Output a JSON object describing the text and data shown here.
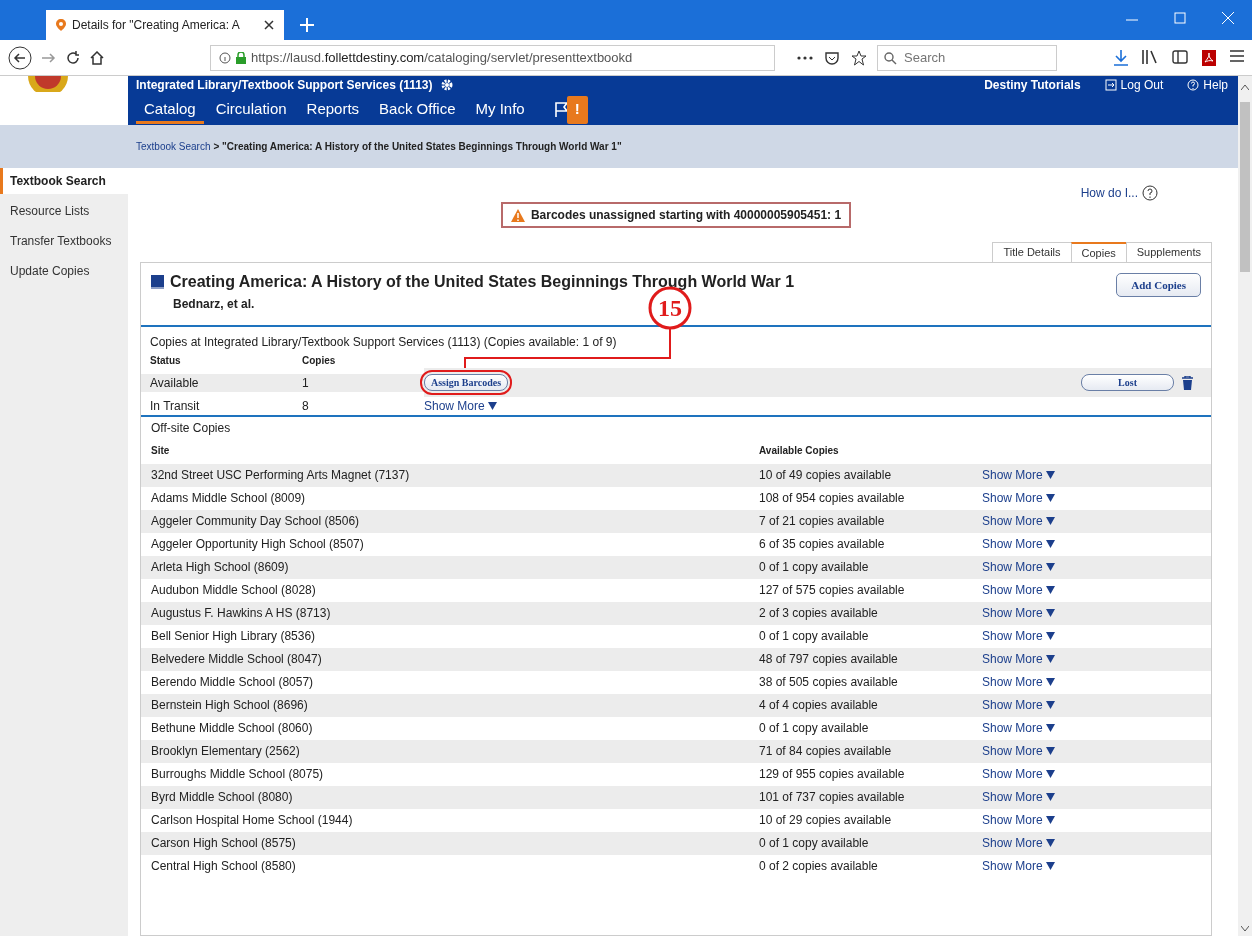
{
  "browser": {
    "tab_title": "Details for \"Creating America: A",
    "url_prefix": "https://lausd.",
    "url_domain": "follettdestiny.com",
    "url_path": "/cataloging/servlet/presenttextbookd",
    "search_placeholder": "Search"
  },
  "header": {
    "site": "Integrated Library/Textbook Support Services (1113)",
    "links": [
      "Destiny Tutorials",
      "Log Out",
      "Help"
    ],
    "nav": [
      {
        "label": "Catalog",
        "selected": true
      },
      {
        "label": "Circulation",
        "selected": false
      },
      {
        "label": "Reports",
        "selected": false
      },
      {
        "label": "Back Office",
        "selected": false
      },
      {
        "label": "My Info",
        "selected": false
      }
    ],
    "flag_badge": "!"
  },
  "breadcrumb": {
    "link": "Textbook Search",
    "current": "> \"Creating America: A History of the United States Beginnings Through World War 1\""
  },
  "sidebar": {
    "items": [
      {
        "label": "Textbook Search",
        "selected": true
      },
      {
        "label": "Resource Lists",
        "selected": false
      },
      {
        "label": "Transfer Textbooks",
        "selected": false
      },
      {
        "label": "Update Copies",
        "selected": false
      }
    ]
  },
  "help_link": "How do I...",
  "alert": "Barcodes unassigned starting with 40000005905451: 1",
  "view_tabs": [
    {
      "label": "Title Details",
      "selected": false
    },
    {
      "label": "Copies",
      "selected": true
    },
    {
      "label": "Supplements",
      "selected": false
    }
  ],
  "title": "Creating America: A History of the United States Beginnings Through World War 1",
  "author": "Bednarz, et al.",
  "add_button": "Add Copies",
  "local_copies": {
    "heading": "Copies at Integrated Library/Textbook Support Services (1113) (Copies available: 1 of 9)",
    "columns": [
      "Status",
      "Copies"
    ],
    "rows": [
      {
        "kind": "button",
        "status": "Available",
        "copies": "1",
        "action": "Assign Barcodes",
        "lost_button": "Lost"
      },
      {
        "kind": "link",
        "status": "In Transit",
        "copies": "8",
        "action": "Show More"
      }
    ]
  },
  "annotation": {
    "label": "15"
  },
  "offsite": {
    "heading": "Off-site Copies",
    "columns": [
      "Site",
      "Available Copies"
    ],
    "rows": [
      {
        "site": "32nd Street USC Performing Arts Magnet (7137)",
        "available": "10 of 49 copies available",
        "action": "Show More"
      },
      {
        "site": "Adams Middle School (8009)",
        "available": "108 of 954 copies available",
        "action": "Show More"
      },
      {
        "site": "Aggeler Community Day School (8506)",
        "available": "7 of 21 copies available",
        "action": "Show More"
      },
      {
        "site": "Aggeler Opportunity High School (8507)",
        "available": "6 of 35 copies available",
        "action": "Show More"
      },
      {
        "site": "Arleta High School (8609)",
        "available": "0 of 1 copy available",
        "action": "Show More"
      },
      {
        "site": "Audubon Middle School (8028)",
        "available": "127 of 575 copies available",
        "action": "Show More"
      },
      {
        "site": "Augustus F. Hawkins A HS (8713)",
        "available": "2 of 3 copies available",
        "action": "Show More"
      },
      {
        "site": "Bell Senior High Library (8536)",
        "available": "0 of 1 copy available",
        "action": "Show More"
      },
      {
        "site": "Belvedere Middle School (8047)",
        "available": "48 of 797 copies available",
        "action": "Show More"
      },
      {
        "site": "Berendo Middle School (8057)",
        "available": "38 of 505 copies available",
        "action": "Show More"
      },
      {
        "site": "Bernstein High School (8696)",
        "available": "4 of 4 copies available",
        "action": "Show More"
      },
      {
        "site": "Bethune Middle School (8060)",
        "available": "0 of 1 copy available",
        "action": "Show More"
      },
      {
        "site": "Brooklyn Elementary (2562)",
        "available": "71 of 84 copies available",
        "action": "Show More"
      },
      {
        "site": "Burroughs Middle School (8075)",
        "available": "129 of 955 copies available",
        "action": "Show More"
      },
      {
        "site": "Byrd Middle School (8080)",
        "available": "101 of 737 copies available",
        "action": "Show More"
      },
      {
        "site": "Carlson Hospital Home School (1944)",
        "available": "10 of 29 copies available",
        "action": "Show More"
      },
      {
        "site": "Carson High School (8575)",
        "available": "0 of 1 copy available",
        "action": "Show More"
      },
      {
        "site": "Central High School (8580)",
        "available": "0 of 2 copies available",
        "action": "Show More"
      }
    ]
  }
}
